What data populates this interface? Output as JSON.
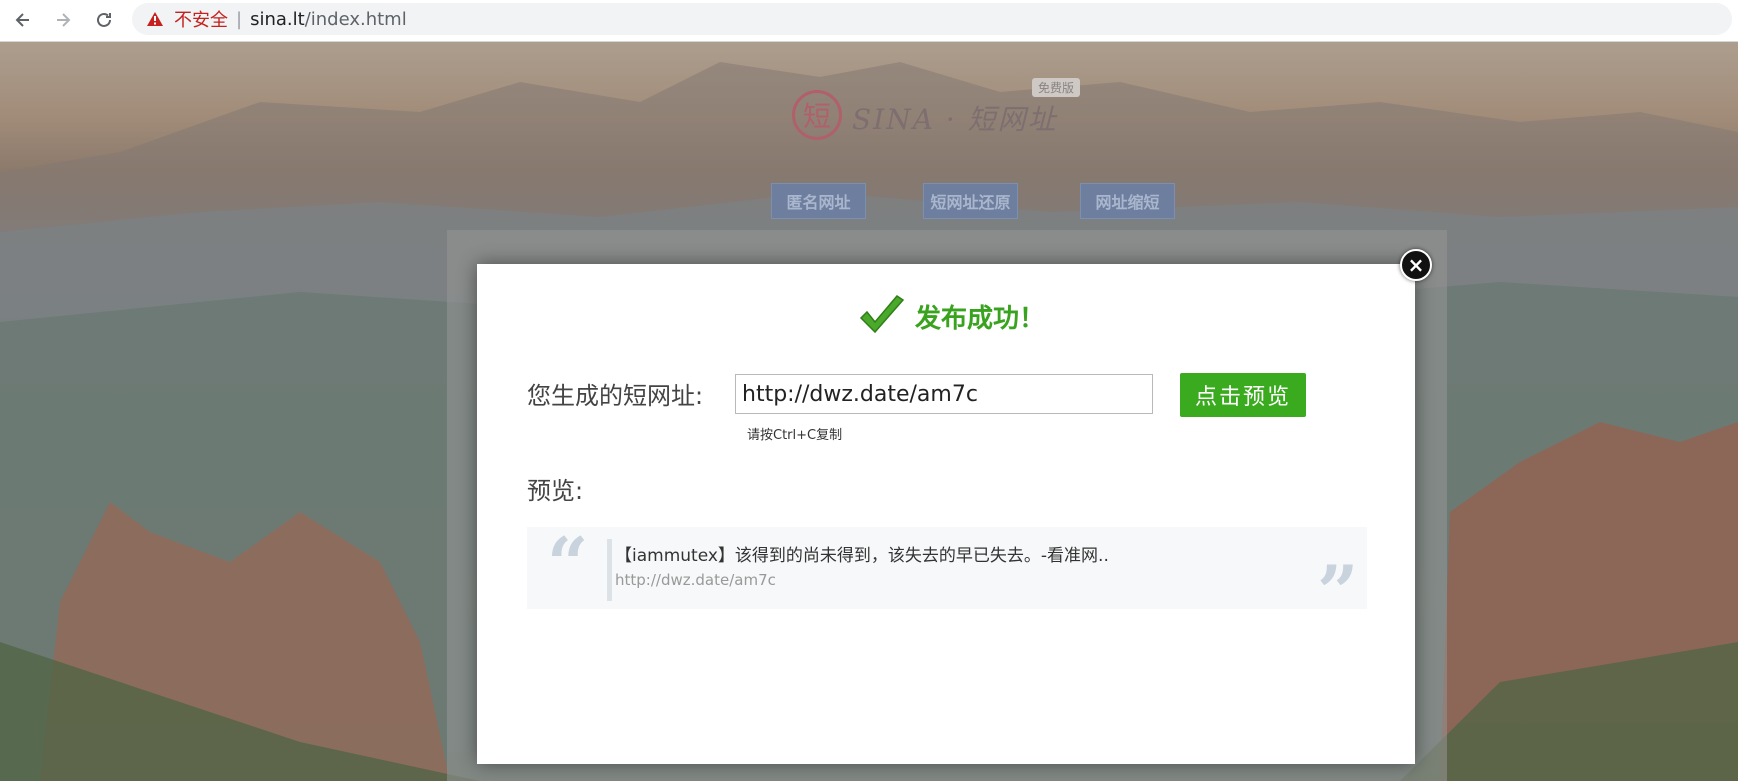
{
  "browser": {
    "back_icon": "arrow-left-icon",
    "forward_icon": "arrow-right-icon",
    "reload_icon": "reload-icon",
    "security_label": "不安全",
    "separator": "|",
    "url_host": "sina.lt",
    "url_path": "/index.html"
  },
  "site": {
    "logo_seal": "短",
    "logo_text": "SINA · 短网址",
    "logo_badge": "免费版",
    "nav": [
      "匿名网址",
      "短网址还原",
      "网址缩短"
    ]
  },
  "modal": {
    "success_title": "发布成功！",
    "short_url_label": "您生成的短网址:",
    "short_url_value": "http://dwz.date/am7c",
    "preview_button": "点击预览",
    "copy_hint": "请按Ctrl+C复制",
    "preview_label": "预览:",
    "preview_title": "【iammutex】该得到的尚未得到，该失去的早已失去。-看准网..",
    "preview_url": "http://dwz.date/am7c",
    "quote_open": "“",
    "quote_close": "”",
    "close_symbol": "×"
  },
  "colors": {
    "success_green": "#39a31f",
    "button_green": "#3aaa1e",
    "insecure_red": "#c5221f"
  }
}
